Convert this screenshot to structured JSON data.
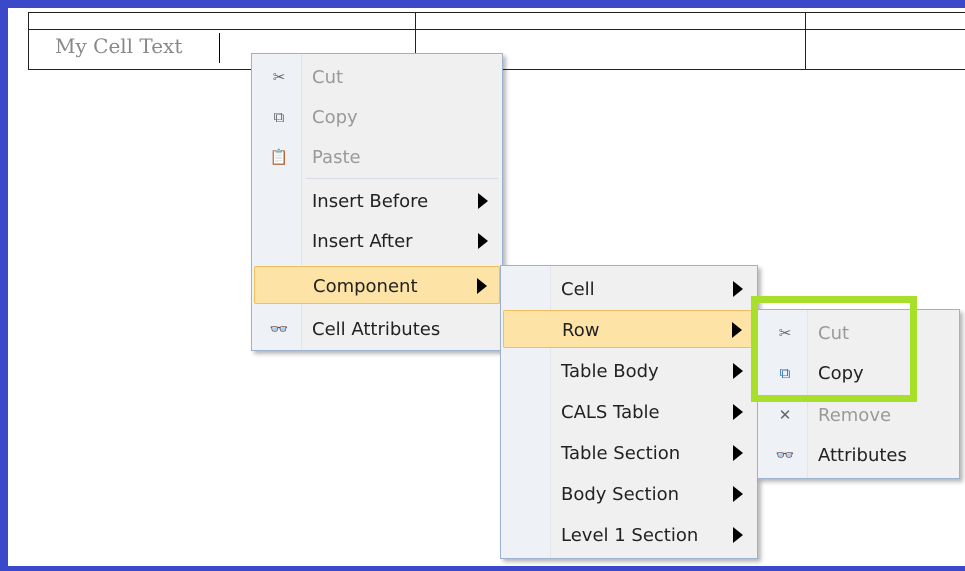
{
  "table": {
    "cell_text": "My Cell Text"
  },
  "context_menu": {
    "items": [
      {
        "label": "Cut",
        "icon": "scissors-icon",
        "disabled": true
      },
      {
        "label": "Copy",
        "icon": "copy-icon",
        "disabled": true
      },
      {
        "label": "Paste",
        "icon": "paste-icon",
        "disabled": true
      },
      {
        "label": "Insert Before"
      },
      {
        "label": "Insert After"
      },
      {
        "label": "Component"
      },
      {
        "label": "Cell Attributes",
        "icon": "glasses-icon"
      }
    ]
  },
  "component_menu": {
    "items": [
      {
        "label": "Cell"
      },
      {
        "label": "Row"
      },
      {
        "label": "Table Body"
      },
      {
        "label": "CALS Table"
      },
      {
        "label": "Table Section"
      },
      {
        "label": "Body Section"
      },
      {
        "label": "Level 1 Section"
      }
    ]
  },
  "row_menu": {
    "items": [
      {
        "label": "Cut",
        "icon": "scissors-icon",
        "disabled": true
      },
      {
        "label": "Copy",
        "icon": "copy-icon"
      },
      {
        "label": "Remove",
        "icon": "remove-icon",
        "disabled": true
      },
      {
        "label": "Attributes",
        "icon": "glasses-icon"
      }
    ]
  },
  "colors": {
    "frame": "#3949c9",
    "hover": "#fde4a6",
    "highlight_box": "#a7df2a"
  }
}
